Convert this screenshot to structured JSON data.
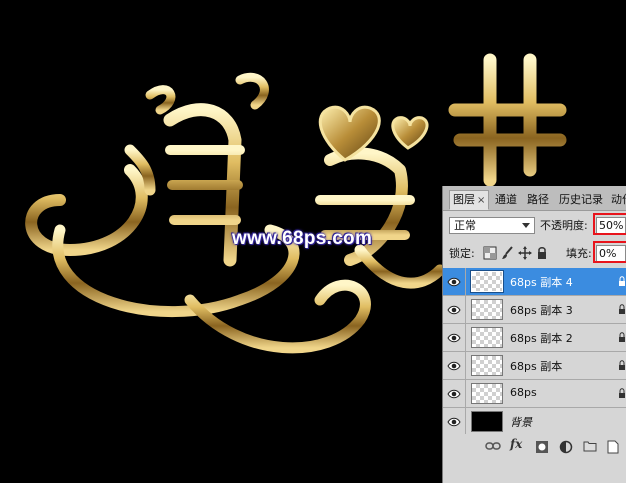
{
  "watermark": "www.68ps.com",
  "panel": {
    "tabs": [
      {
        "label": "图层",
        "close": "×"
      },
      {
        "label": "通道"
      },
      {
        "label": "路径"
      },
      {
        "label": "历史记录"
      },
      {
        "label": "动作"
      }
    ],
    "blend_mode": "正常",
    "opacity_label": "不透明度:",
    "opacity_value": "50%",
    "lock_label": "锁定:",
    "fill_label": "填充:",
    "fill_value": "0%",
    "layers": [
      {
        "name": "68ps 副本 4",
        "selected": true
      },
      {
        "name": "68ps 副本 3"
      },
      {
        "name": "68ps 副本 2"
      },
      {
        "name": "68ps  副本"
      },
      {
        "name": "68ps"
      },
      {
        "name": "背景"
      }
    ]
  },
  "colors": {
    "selection": "#3b8ce0",
    "highlight_box": "#e8141c",
    "gold": "#d9b45a"
  },
  "icons": [
    "eye-icon",
    "lock-icon",
    "link-icon",
    "fx-icon",
    "mask-icon",
    "adjustment-icon",
    "folder-icon"
  ]
}
